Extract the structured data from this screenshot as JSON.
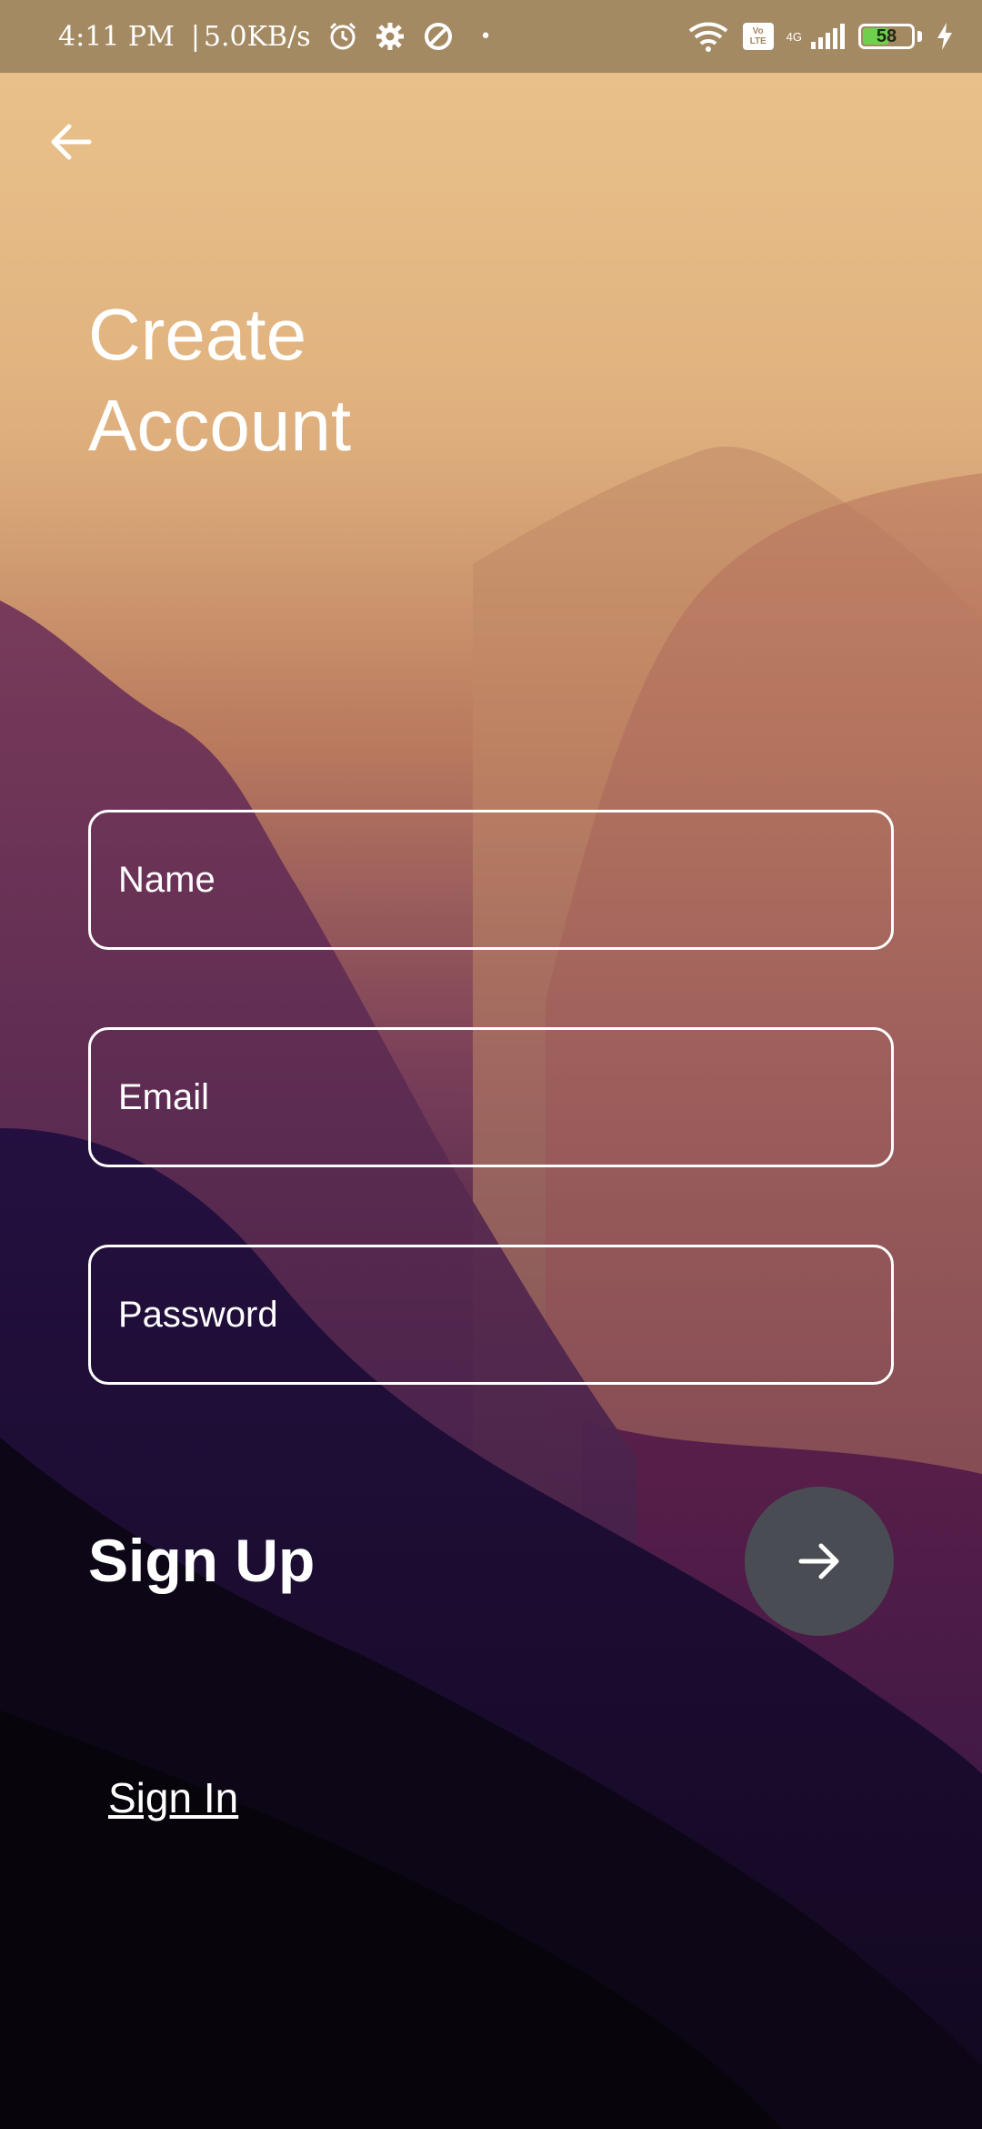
{
  "status_bar": {
    "time": "4:11 PM",
    "separator": "|",
    "net_speed": "5.0KB/s",
    "dot": "•",
    "volte_top": "Vo",
    "volte_bottom": "LTE",
    "network_type": "4G",
    "battery_level": 58,
    "battery_text": "58",
    "icons": [
      "alarm-icon",
      "gear-icon",
      "data-saver-icon",
      "wifi-icon",
      "volte-icon",
      "signal-icon",
      "battery-icon",
      "charging-icon"
    ]
  },
  "header": {
    "back_icon": "arrow-left-icon",
    "title_line1": "Create",
    "title_line2": "Account"
  },
  "form": {
    "name_placeholder": "Name",
    "email_placeholder": "Email",
    "password_placeholder": "Password",
    "signup_label": "Sign Up",
    "submit_icon": "arrow-right-icon",
    "signin_link": "Sign In"
  },
  "colors": {
    "status_bar_bg": "#a48a63",
    "submit_button_bg": "#4a4c54",
    "text": "#ffffff",
    "battery_fill": "#6fd14b"
  }
}
